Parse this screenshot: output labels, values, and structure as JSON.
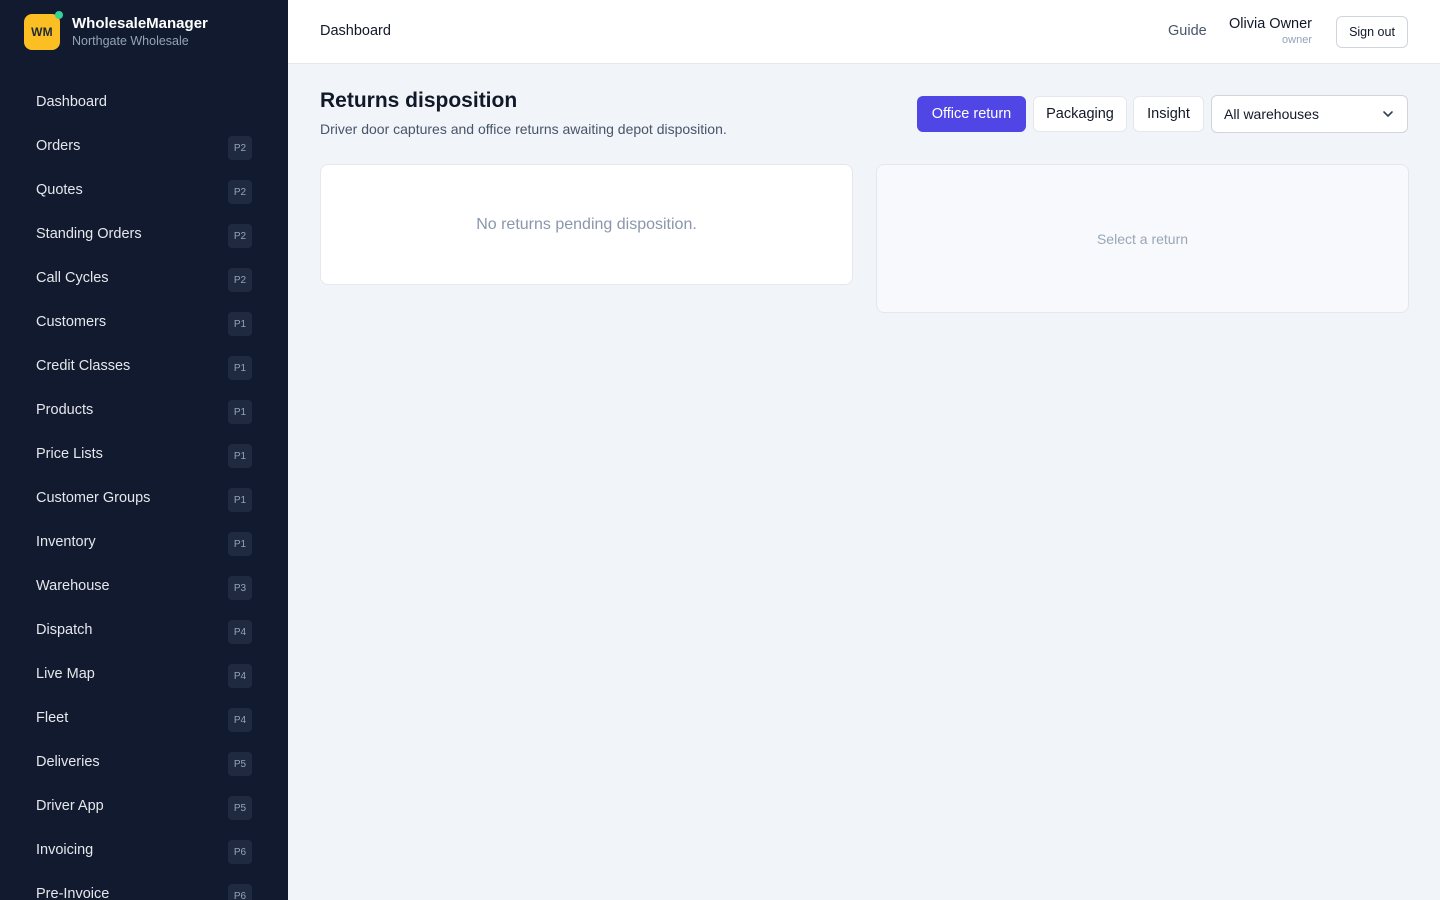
{
  "app": {
    "logo": "WM",
    "name": "WholesaleManager",
    "company": "Northgate Wholesale"
  },
  "sidebar": {
    "items": [
      {
        "label": "Dashboard",
        "badge": ""
      },
      {
        "label": "Orders",
        "badge": "P2"
      },
      {
        "label": "Quotes",
        "badge": "P2"
      },
      {
        "label": "Standing Orders",
        "badge": "P2"
      },
      {
        "label": "Call Cycles",
        "badge": "P2"
      },
      {
        "label": "Customers",
        "badge": "P1"
      },
      {
        "label": "Credit Classes",
        "badge": "P1"
      },
      {
        "label": "Products",
        "badge": "P1"
      },
      {
        "label": "Price Lists",
        "badge": "P1"
      },
      {
        "label": "Customer Groups",
        "badge": "P1"
      },
      {
        "label": "Inventory",
        "badge": "P1"
      },
      {
        "label": "Warehouse",
        "badge": "P3"
      },
      {
        "label": "Dispatch",
        "badge": "P4"
      },
      {
        "label": "Live Map",
        "badge": "P4"
      },
      {
        "label": "Fleet",
        "badge": "P4"
      },
      {
        "label": "Deliveries",
        "badge": "P5"
      },
      {
        "label": "Driver App",
        "badge": "P5"
      },
      {
        "label": "Invoicing",
        "badge": "P6"
      },
      {
        "label": "Pre-Invoice",
        "badge": "P6"
      }
    ]
  },
  "header": {
    "breadcrumb": "Dashboard",
    "guide": "Guide",
    "user_name": "Olivia Owner",
    "user_role": "owner",
    "sign_out": "Sign out"
  },
  "main": {
    "title": "Returns disposition",
    "subtitle": "Driver door captures and office returns awaiting depot disposition.",
    "tabs": [
      {
        "label": "Office return",
        "active": true
      },
      {
        "label": "Packaging",
        "active": false
      },
      {
        "label": "Insight",
        "active": false
      }
    ],
    "warehouse_select": "All warehouses",
    "empty_list": "No returns pending disposition.",
    "detail_placeholder": "Select a return"
  },
  "colors": {
    "sidebar_bg": "#111a2e",
    "accent": "#4f46e5",
    "logo_bg": "#fbbf24",
    "status_dot": "#34d399"
  }
}
